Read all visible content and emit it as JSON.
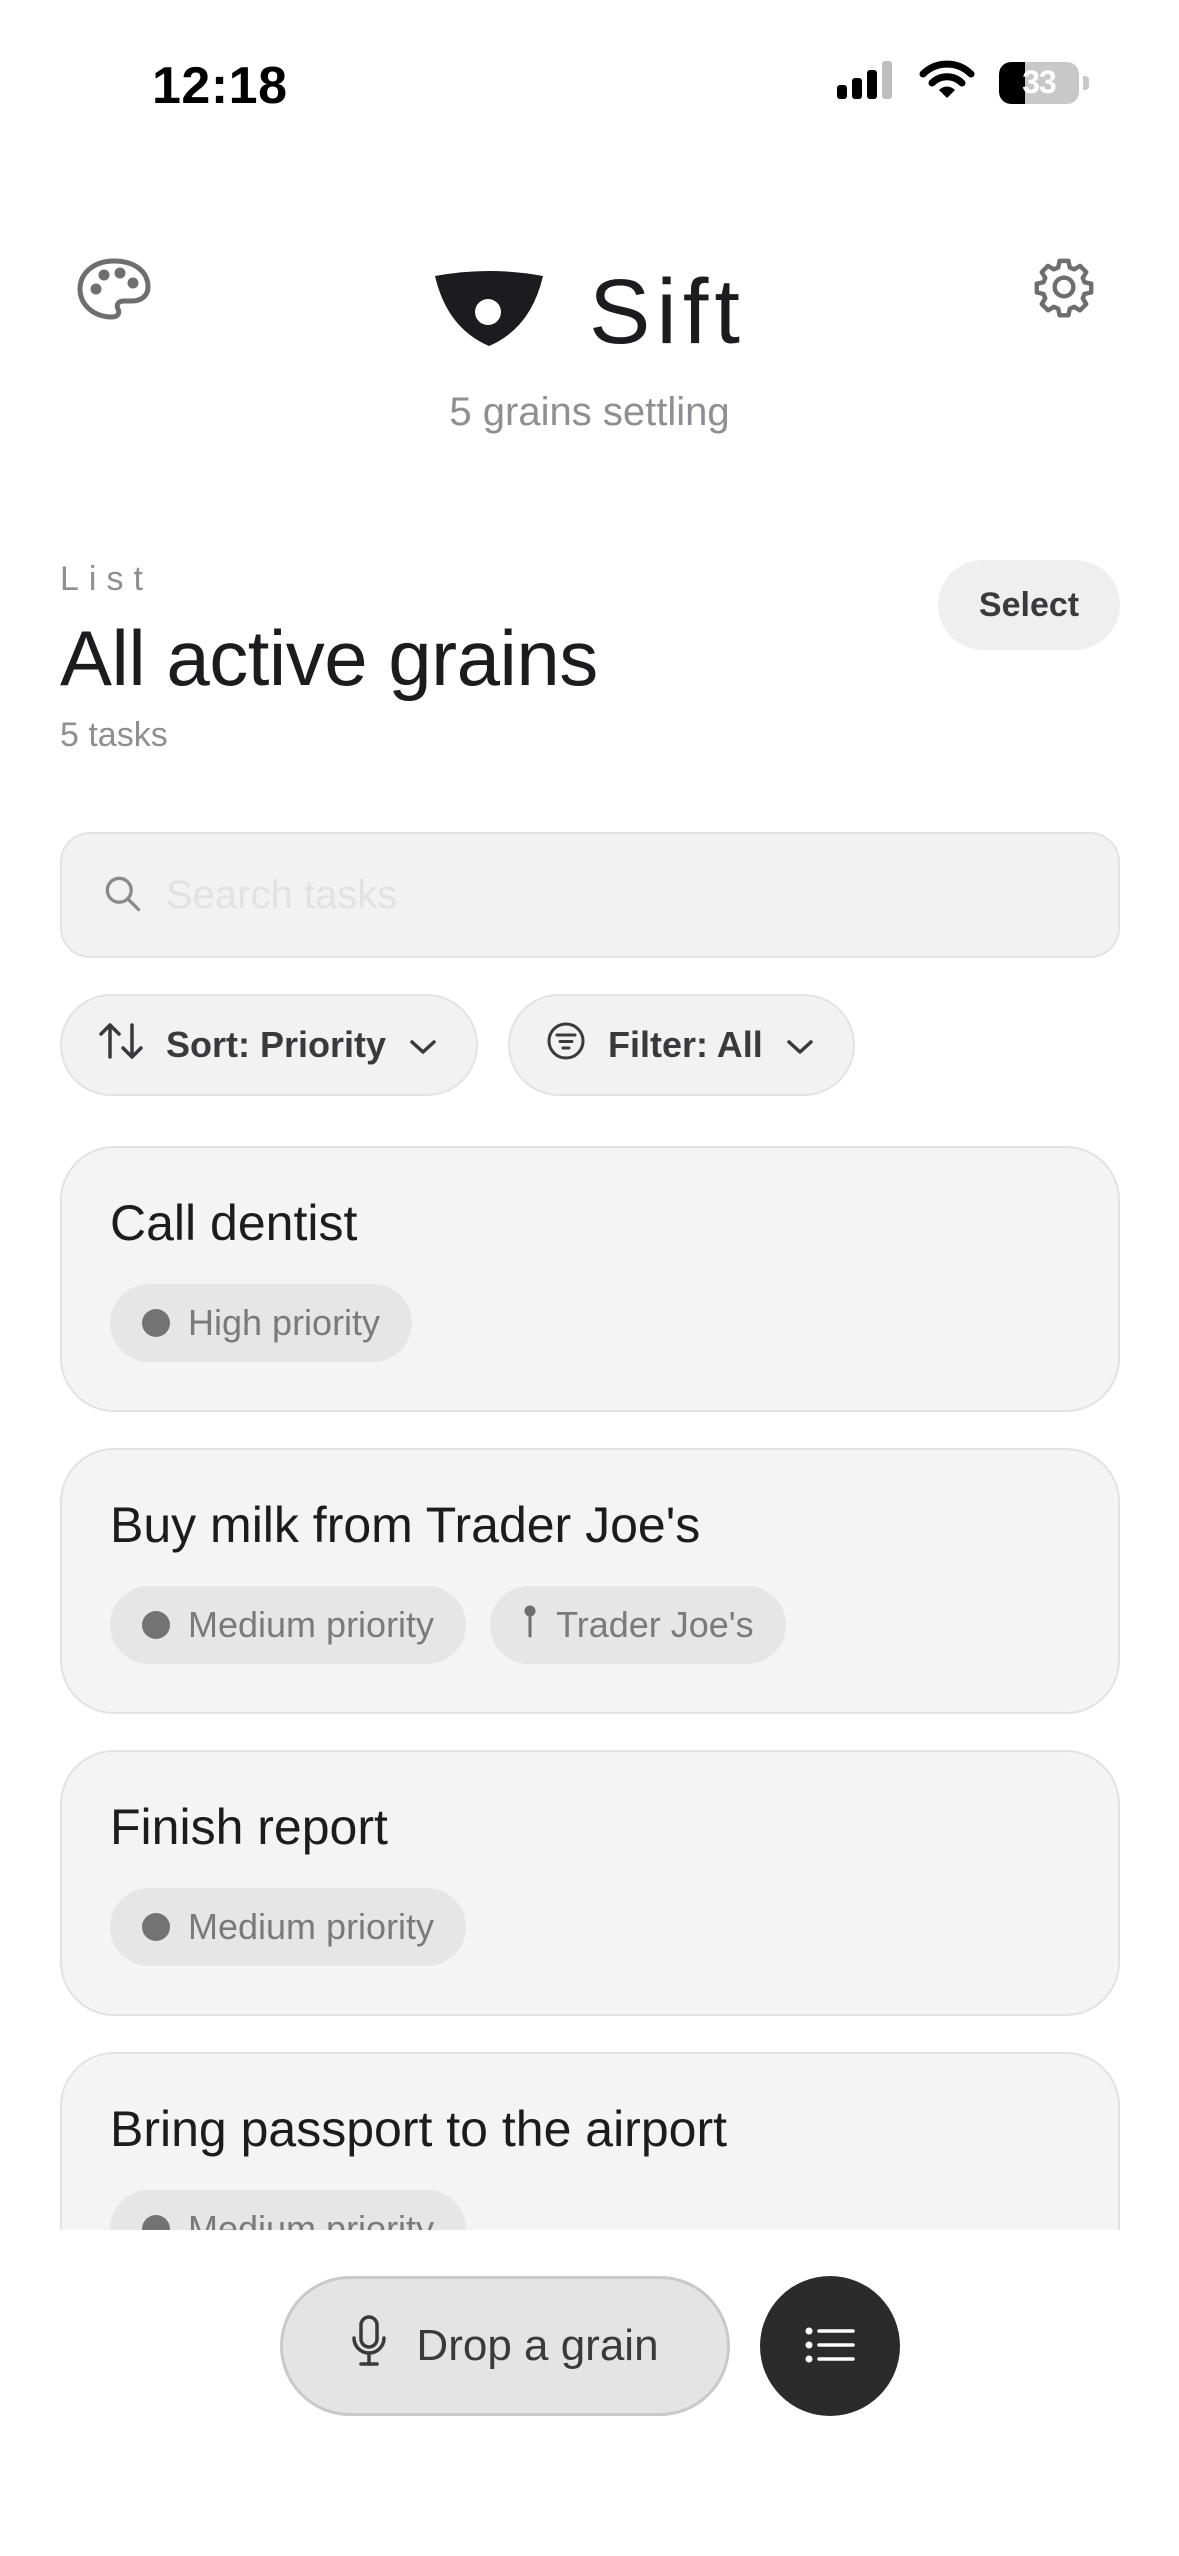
{
  "status_bar": {
    "time": "12:18",
    "battery_percent": "33",
    "battery_level": 0.33
  },
  "header": {
    "app_name": "Sift",
    "subtitle": "5 grains settling"
  },
  "list": {
    "kicker": "List",
    "title": "All active grains",
    "count": "5 tasks",
    "select_label": "Select"
  },
  "search": {
    "placeholder": "Search tasks",
    "value": ""
  },
  "toolbar": {
    "sort_label": "Sort: Priority",
    "filter_label": "Filter: All"
  },
  "tasks": [
    {
      "title": "Call dentist",
      "tags": [
        {
          "type": "priority",
          "label": "High priority"
        }
      ]
    },
    {
      "title": "Buy milk from Trader Joe's",
      "tags": [
        {
          "type": "priority",
          "label": "Medium priority"
        },
        {
          "type": "location",
          "label": "Trader Joe's"
        }
      ]
    },
    {
      "title": "Finish report",
      "tags": [
        {
          "type": "priority",
          "label": "Medium priority"
        }
      ]
    },
    {
      "title": "Bring passport to the airport",
      "tags": [
        {
          "type": "priority",
          "label": "Medium priority"
        }
      ]
    }
  ],
  "bottom_bar": {
    "drop_label": "Drop a grain"
  },
  "icons": {
    "palette": "palette-icon",
    "gear": "gear-icon",
    "logo": "sift-logo-icon",
    "search": "search-icon",
    "sort": "sort-arrows-icon",
    "filter": "filter-icon",
    "chevron": "chevron-down-icon",
    "pin": "pin-icon",
    "mic": "microphone-icon",
    "list": "list-icon"
  },
  "colors": {
    "text": "#1c1c1e",
    "muted": "#8e8e93",
    "surface": "#f4f4f4",
    "fab": "#2b2b2b"
  }
}
